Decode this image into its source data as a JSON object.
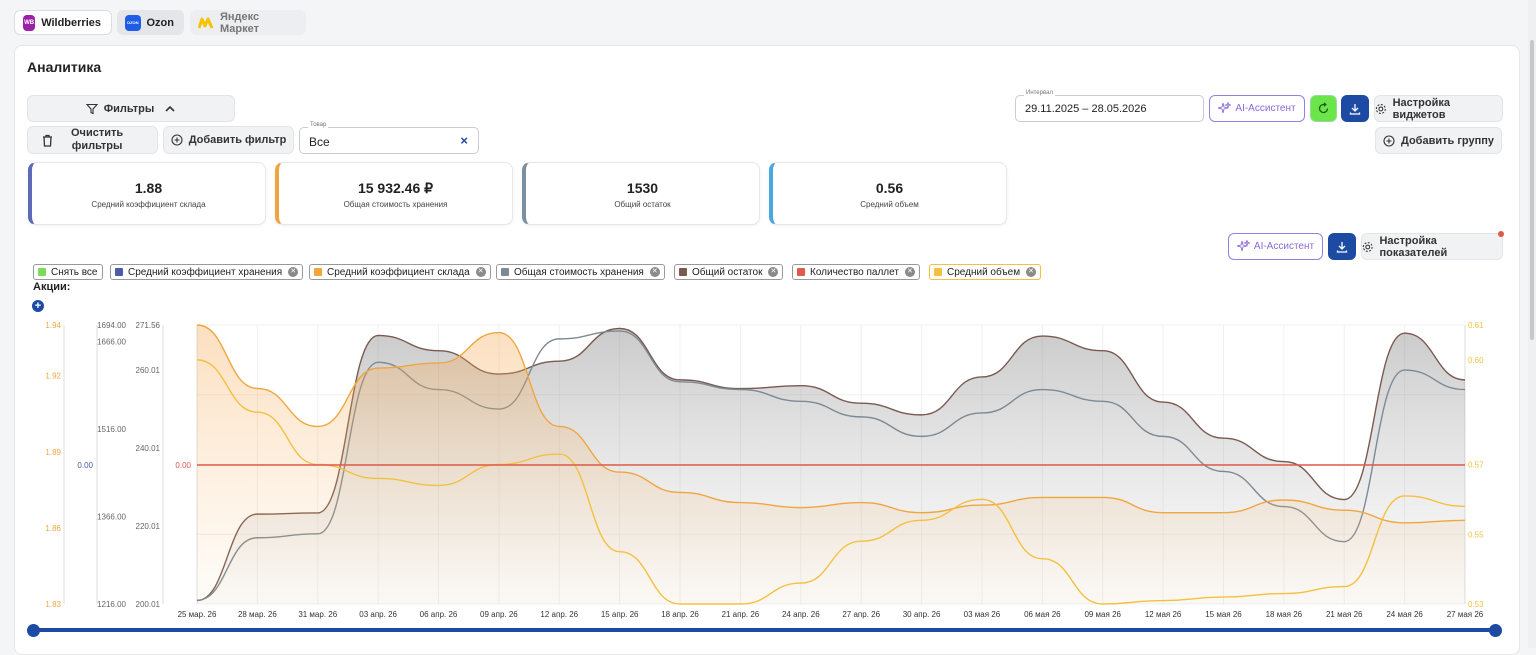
{
  "marketplaces": [
    {
      "label": "Wildberries",
      "logo_text": "WB",
      "color": "#9b1fa8"
    },
    {
      "label": "Ozon",
      "logo_text": "OZON",
      "color": "#1f5de8"
    },
    {
      "label": "Яндекс Маркет",
      "logo_text": "",
      "color": "#f5c400"
    }
  ],
  "page": {
    "title": "Аналитика"
  },
  "filters": {
    "toggle_label": "Фильтры",
    "clear_label_line1": "Очистить",
    "clear_label_line2": "фильтры",
    "add_filter_label": "Добавить фильтр",
    "product_field_label": "Товар",
    "product_value": "Все"
  },
  "toolbar": {
    "interval_label": "Интервал",
    "interval_value": "29.11.2025 – 28.05.2026",
    "ai_label": "AI-Ассистент",
    "widgets_settings_label": "Настройка виджетов",
    "add_group_label": "Добавить группу"
  },
  "kpis": [
    {
      "value": "1.88",
      "caption": "Средний коэффициент склада",
      "color": "#5b6bb5"
    },
    {
      "value": "15 932.46 ₽",
      "caption": "Общая стоимость хранения",
      "color": "#f0a640"
    },
    {
      "value": "1530",
      "caption": "Общий остаток",
      "color": "#7a8fa0"
    },
    {
      "value": "0.56",
      "caption": "Средний объем",
      "color": "#4aa8e0"
    }
  ],
  "chart_toolbar": {
    "ai_label": "AI-Ассистент",
    "metrics_settings_label": "Настройка показателей"
  },
  "legend": [
    {
      "label": "Снять все",
      "color": "#7ddc5a",
      "removable": false
    },
    {
      "label": "Средний коэффициент хранения",
      "color": "#4a5ba8",
      "removable": true
    },
    {
      "label": "Средний коэффициент склада",
      "color": "#f0a640",
      "removable": true
    },
    {
      "label": "Общая стоимость хранения",
      "color": "#7e8a93",
      "removable": true
    },
    {
      "label": "Общий остаток",
      "color": "#7a5a50",
      "removable": true
    },
    {
      "label": "Количество паллет",
      "color": "#e05a4a",
      "removable": true
    },
    {
      "label": "Средний объем",
      "color": "#f5c040",
      "removable": true
    }
  ],
  "promotions_label": "Акции:",
  "chart_data": {
    "type": "area",
    "x": [
      "25 мар. 26",
      "28 мар. 26",
      "31 мар. 26",
      "03 апр. 26",
      "06 апр. 26",
      "09 апр. 26",
      "12 апр. 26",
      "15 апр. 26",
      "18 апр. 26",
      "21 апр. 26",
      "24 апр. 26",
      "27 апр. 26",
      "30 апр. 26",
      "03 мая 26",
      "06 мая 26",
      "09 мая 26",
      "12 мая 26",
      "15 мая 26",
      "18 мая 26",
      "21 мая 26",
      "24 мая 26",
      "27 мая 26"
    ],
    "axes": {
      "warehouse_coef": {
        "ticks": [
          "1.94",
          "1.92",
          "1.89",
          "1.86",
          "1.83"
        ],
        "range": [
          1.83,
          1.94
        ],
        "color": "#f0a640"
      },
      "storage_coef": {
        "ticks": [
          "0.00"
        ],
        "color": "#4a5ba8"
      },
      "remaining": {
        "ticks": [
          "1694.00",
          "1666.00",
          "1516.00",
          "1366.00",
          "1216.00"
        ],
        "range": [
          1216,
          1694
        ],
        "color": "#666"
      },
      "storage_cost": {
        "ticks": [
          "271.56",
          "260.01",
          "240.01",
          "220.01",
          "200.01"
        ],
        "range": [
          200.01,
          271.56
        ],
        "color": "#666"
      },
      "pallets": {
        "ticks": [
          "0.00"
        ],
        "color": "#e05a4a"
      },
      "avg_volume": {
        "ticks": [
          "0.61",
          "0.60",
          "0.57",
          "0.55",
          "0.53"
        ],
        "range": [
          0.53,
          0.61
        ],
        "color": "#f5c040"
      }
    },
    "series": [
      {
        "name": "Общий остаток",
        "color": "#7a5a50",
        "values": [
          1222,
          1370,
          1372,
          1676,
          1650,
          1610,
          1632,
          1688,
          1600,
          1585,
          1590,
          1560,
          1540,
          1605,
          1675,
          1650,
          1562,
          1500,
          1460,
          1395,
          1680,
          1600
        ]
      },
      {
        "name": "Общая стоимость хранения",
        "color": "#7e8a93",
        "values": [
          201,
          217,
          218,
          262,
          255,
          250,
          268,
          270,
          257,
          255,
          252,
          248,
          243,
          249,
          255,
          252,
          243,
          234,
          225,
          216,
          260,
          255
        ]
      },
      {
        "name": "Средний коэффициент склада",
        "color": "#f0a640",
        "values": [
          1.94,
          1.915,
          1.9,
          1.923,
          1.925,
          1.937,
          1.9,
          1.882,
          1.874,
          1.87,
          1.868,
          1.87,
          1.866,
          1.869,
          1.872,
          1.872,
          1.866,
          1.866,
          1.871,
          1.867,
          1.862,
          1.863
        ]
      },
      {
        "name": "Средний объем",
        "color": "#f5c040",
        "values": [
          0.6,
          0.585,
          0.57,
          0.566,
          0.564,
          0.57,
          0.573,
          0.545,
          0.53,
          0.53,
          0.536,
          0.548,
          0.554,
          0.56,
          0.543,
          0.53,
          0.531,
          0.532,
          0.533,
          0.535,
          0.561,
          0.558
        ]
      },
      {
        "name": "Количество паллет",
        "color": "#e05a4a",
        "values": [
          0,
          0,
          0,
          0,
          0,
          0,
          0,
          0,
          0,
          0,
          0,
          0,
          0,
          0,
          0,
          0,
          0,
          0,
          0,
          0,
          0,
          0
        ]
      }
    ],
    "grid": true
  },
  "range_slider": {
    "start": 0,
    "end": 1
  }
}
